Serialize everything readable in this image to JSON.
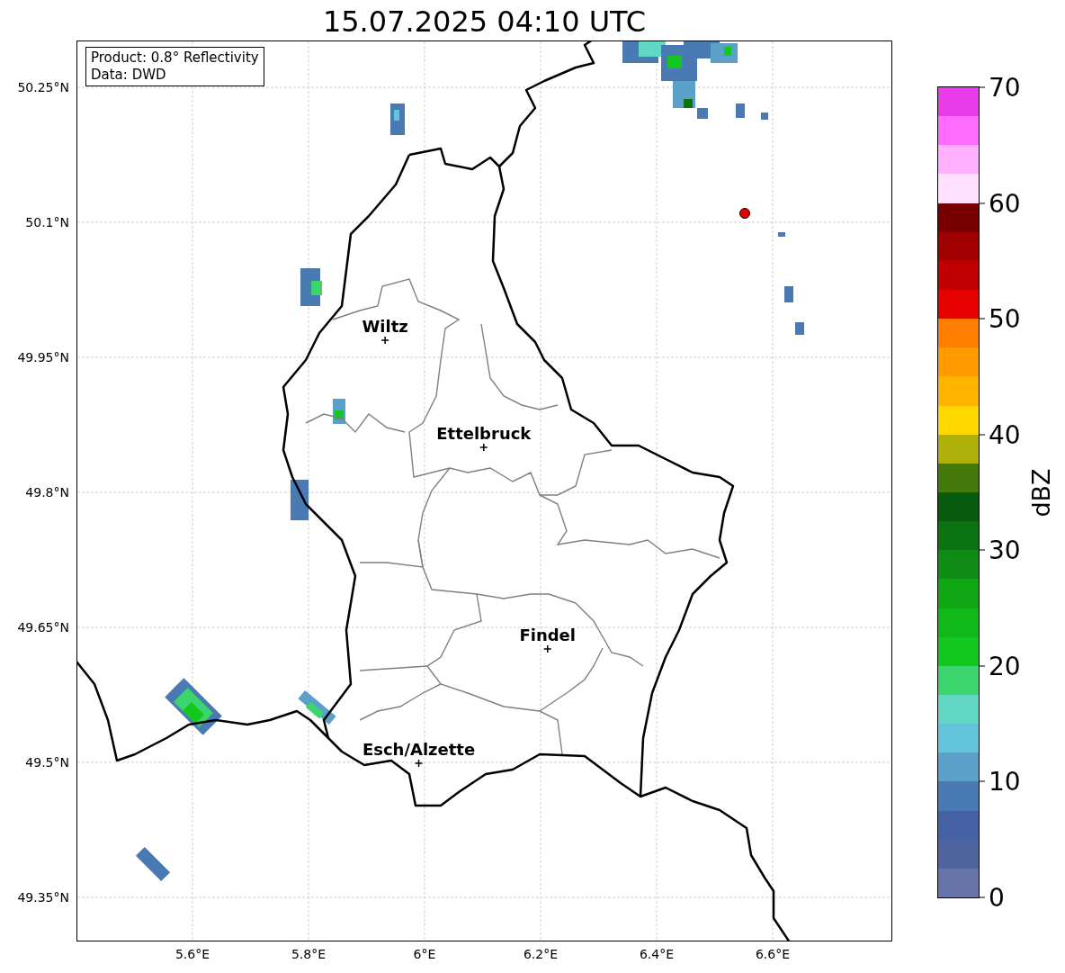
{
  "title": "15.07.2025 04:10 UTC",
  "map": {
    "legend": [
      "Product: 0.8° Reflectivity",
      "Data: DWD"
    ],
    "lat_ticks": [
      "50.25°N",
      "50.1°N",
      "49.95°N",
      "49.8°N",
      "49.65°N",
      "49.5°N",
      "49.35°N"
    ],
    "lon_ticks": [
      "5.6°E",
      "5.8°E",
      "6°E",
      "6.2°E",
      "6.4°E",
      "6.6°E"
    ],
    "cities": [
      {
        "name": "Wiltz"
      },
      {
        "name": "Ettelbruck"
      },
      {
        "name": "Findel"
      },
      {
        "name": "Esch/Alzette"
      }
    ]
  },
  "colorbar": {
    "label": "dBZ",
    "ticks": [
      "70",
      "60",
      "50",
      "40",
      "30",
      "20",
      "10",
      "0"
    ],
    "bins": [
      {
        "color": "#e83ce8"
      },
      {
        "color": "#ff6cff"
      },
      {
        "color": "#ffb0ff"
      },
      {
        "color": "#ffe0ff"
      },
      {
        "color": "#780000"
      },
      {
        "color": "#a00000"
      },
      {
        "color": "#c00000"
      },
      {
        "color": "#e60000"
      },
      {
        "color": "#ff7e00"
      },
      {
        "color": "#ff9a00"
      },
      {
        "color": "#ffb400"
      },
      {
        "color": "#ffd800"
      },
      {
        "color": "#b0b00a"
      },
      {
        "color": "#447a0c"
      },
      {
        "color": "#085a0c"
      },
      {
        "color": "#0a7410"
      },
      {
        "color": "#0e8c14"
      },
      {
        "color": "#10a614"
      },
      {
        "color": "#10b81a"
      },
      {
        "color": "#12c81e"
      },
      {
        "color": "#3cd46c"
      },
      {
        "color": "#62d8c4"
      },
      {
        "color": "#64c4dc"
      },
      {
        "color": "#5aa0c8"
      },
      {
        "color": "#4a7ab4"
      },
      {
        "color": "#4462a4"
      },
      {
        "color": "#50649e"
      },
      {
        "color": "#6674a8"
      }
    ]
  }
}
